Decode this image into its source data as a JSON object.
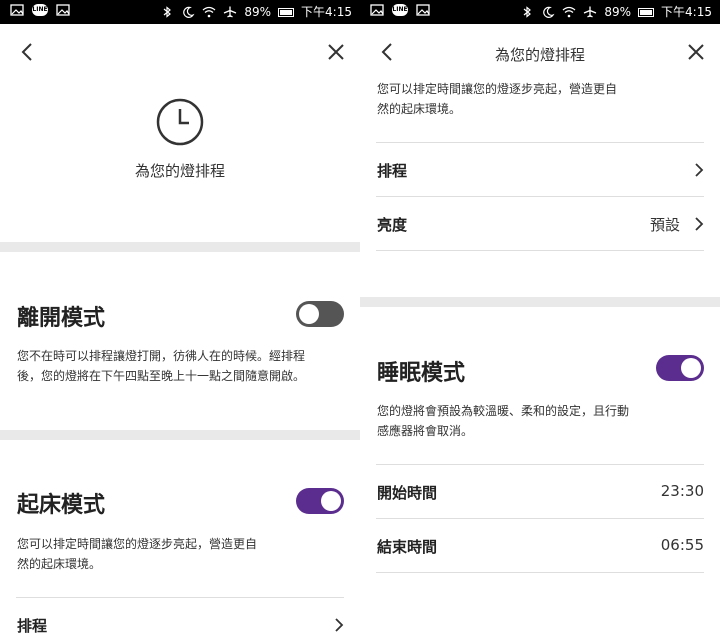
{
  "status_bar": {
    "battery": "89%",
    "time": "下午4:15",
    "line_badge": "LINE"
  },
  "left": {
    "hero_title": "為您的燈排程",
    "away_mode": {
      "title": "離開模式",
      "desc_line1": "您不在時可以排程讓燈打開，彷彿人在的時候。經排程",
      "desc_line2": "後，您的燈將在下午四點至晚上十一點之間隨意開啟。",
      "enabled": false
    },
    "wake_mode": {
      "title": "起床模式",
      "desc_line1": "您可以排定時間讓您的燈逐步亮起，營造更自",
      "desc_line2": "然的起床環境。",
      "enabled": true
    },
    "schedule_label": "排程"
  },
  "right": {
    "header_title": "為您的燈排程",
    "intro_line1": "您可以排定時間讓您的燈逐步亮起，營造更自",
    "intro_line2": "然的起床環境。",
    "schedule_label": "排程",
    "brightness_label": "亮度",
    "brightness_value": "預設",
    "sleep_mode": {
      "title": "睡眠模式",
      "desc_line1": "您的燈將會預設為較溫暖、柔和的設定，且行動",
      "desc_line2": "感應器將會取消。",
      "enabled": true
    },
    "start_time_label": "開始時間",
    "start_time_value": "23:30",
    "end_time_label": "結束時間",
    "end_time_value": "06:55"
  },
  "colors": {
    "toggle_on": "#5b2d8e",
    "toggle_off": "#555555",
    "band": "#e9e9e9"
  }
}
